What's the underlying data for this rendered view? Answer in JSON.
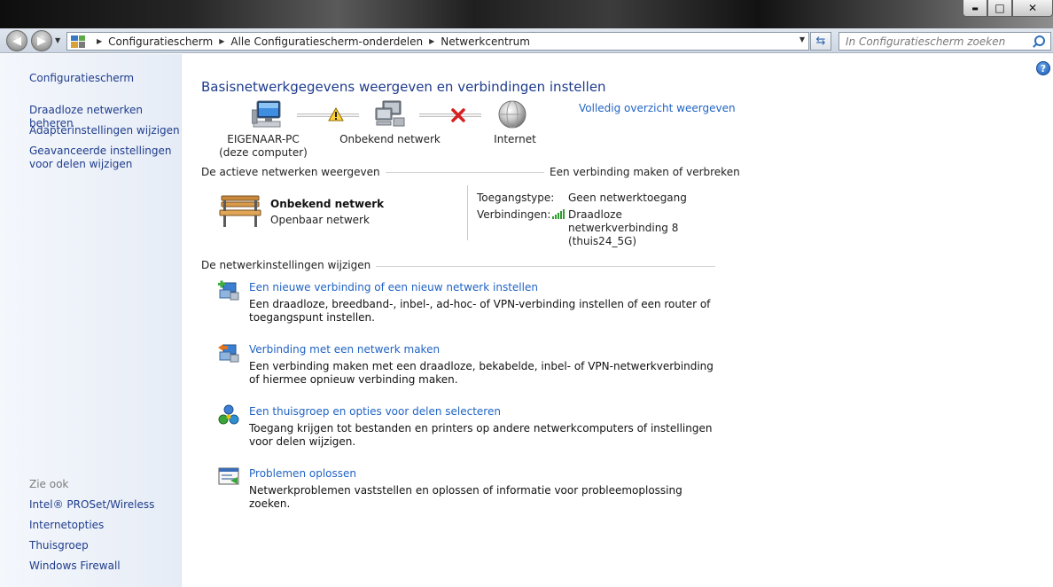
{
  "window": {
    "caption_buttons": {
      "minimize": "▬",
      "maximize": "□",
      "close": "✕"
    }
  },
  "nav": {
    "back_icon": "back-arrow-icon",
    "forward_icon": "forward-arrow-icon",
    "breadcrumbs": [
      "Configuratiescherm",
      "Alle Configuratiescherm-onderdelen",
      "Netwerkcentrum"
    ],
    "search_placeholder": "In Configuratiescherm zoeken"
  },
  "sidebar": {
    "home": "Configuratiescherm",
    "links": [
      "Draadloze netwerken beheren",
      "Adapterinstellingen wijzigen",
      "Geavanceerde instellingen voor delen wijzigen"
    ],
    "see_also_heading": "Zie ook",
    "see_also": [
      "Intel® PROSet/Wireless",
      "Internetopties",
      "Thuisgroep",
      "Windows Firewall"
    ]
  },
  "main": {
    "title": "Basisnetwerkgegevens weergeven en verbindingen instellen",
    "full_map_link": "Volledig overzicht weergeven",
    "map": {
      "computer_name": "EIGENAAR-PC",
      "computer_sub": "(deze computer)",
      "network": "Onbekend netwerk",
      "internet": "Internet",
      "status_warning_icon": "warning-icon",
      "status_error_icon": "red-x-icon"
    },
    "active_networks": {
      "heading": "De actieve netwerken weergeven",
      "connect_link": "Een verbinding maken of verbreken",
      "network_name": "Onbekend netwerk",
      "network_type": "Openbaar netwerk",
      "access_label": "Toegangstype:",
      "access_value": "Geen netwerktoegang",
      "connections_label": "Verbindingen:",
      "connection_name": "Draadloze netwerkverbinding 8",
      "connection_ssid": "(thuis24_5G)"
    },
    "change_settings": {
      "heading": "De netwerkinstellingen wijzigen",
      "tasks": [
        {
          "title": "Een nieuwe verbinding of een nieuw netwerk instellen",
          "desc": "Een draadloze, breedband-, inbel-, ad-hoc- of VPN-verbinding instellen of een router of toegangspunt instellen."
        },
        {
          "title": "Verbinding met een netwerk maken",
          "desc": "Een verbinding maken met een draadloze, bekabelde, inbel- of VPN-netwerkverbinding of hiermee opnieuw verbinding maken."
        },
        {
          "title": "Een thuisgroep en opties voor delen selecteren",
          "desc": "Toegang krijgen tot bestanden en printers op andere netwerkcomputers of instellingen voor delen wijzigen."
        },
        {
          "title": "Problemen oplossen",
          "desc": "Netwerkproblemen vaststellen en oplossen of informatie voor probleemoplossing zoeken."
        }
      ]
    }
  }
}
